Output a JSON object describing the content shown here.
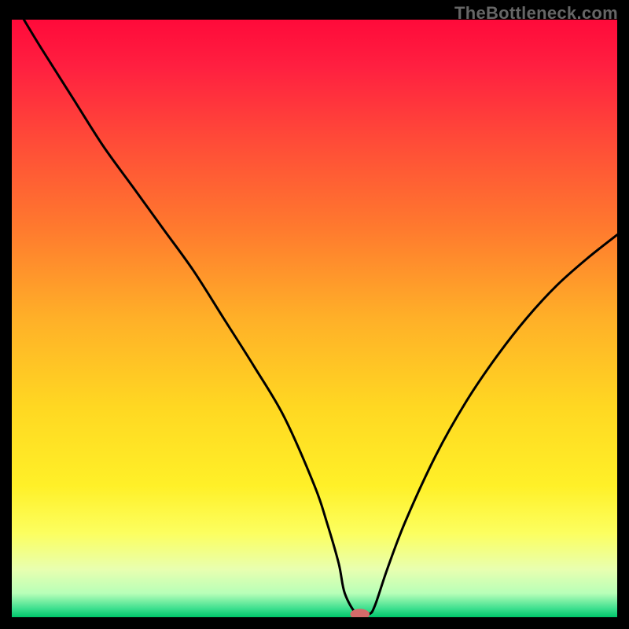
{
  "watermark": "TheBottleneck.com",
  "chart_data": {
    "type": "line",
    "title": "",
    "xlabel": "",
    "ylabel": "",
    "xlim": [
      0,
      100
    ],
    "ylim": [
      0,
      100
    ],
    "background_gradient": {
      "stops": [
        {
          "offset": 0.0,
          "color": "#ff0a3a"
        },
        {
          "offset": 0.08,
          "color": "#ff2040"
        },
        {
          "offset": 0.2,
          "color": "#ff4a38"
        },
        {
          "offset": 0.35,
          "color": "#ff7a2e"
        },
        {
          "offset": 0.5,
          "color": "#ffb028"
        },
        {
          "offset": 0.65,
          "color": "#ffd822"
        },
        {
          "offset": 0.78,
          "color": "#fff028"
        },
        {
          "offset": 0.86,
          "color": "#fcff60"
        },
        {
          "offset": 0.92,
          "color": "#e8ffb0"
        },
        {
          "offset": 0.96,
          "color": "#b8ffb8"
        },
        {
          "offset": 0.985,
          "color": "#40e090"
        },
        {
          "offset": 1.0,
          "color": "#00c66a"
        }
      ]
    },
    "series": [
      {
        "name": "bottleneck-curve",
        "color": "#000000",
        "x": [
          2,
          5,
          10,
          15,
          20,
          25,
          30,
          35,
          40,
          45,
          50,
          52,
          54,
          55,
          57,
          59,
          60,
          62,
          65,
          70,
          75,
          80,
          85,
          90,
          95,
          100
        ],
        "y": [
          100,
          95,
          87,
          79,
          72,
          65,
          58,
          50,
          42,
          33.5,
          22,
          16,
          9,
          4,
          0.5,
          0.5,
          2,
          8,
          16,
          27,
          36,
          43.5,
          50,
          55.5,
          60,
          64
        ]
      }
    ],
    "marker": {
      "name": "optimal-point",
      "x": 57.5,
      "y": 0.5,
      "color": "#d46a6a",
      "rx": 1.6,
      "ry": 0.9
    }
  }
}
